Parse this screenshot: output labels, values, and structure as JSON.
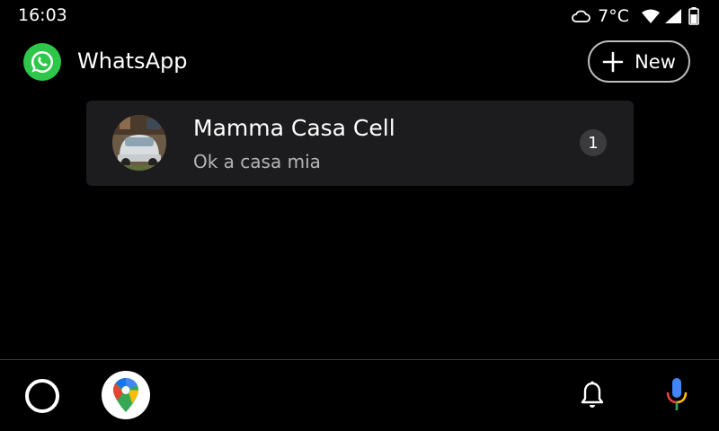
{
  "status_bar": {
    "time": "16:03",
    "temperature": "7°C",
    "weather_icon": "cloud-icon",
    "wifi_icon": "wifi-icon",
    "signal_icon": "cell-signal-icon",
    "battery_icon": "battery-icon"
  },
  "header": {
    "app_title": "WhatsApp",
    "app_icon": "whatsapp-icon",
    "new_button_label": "New"
  },
  "conversations": [
    {
      "name": "Mamma Casa Cell",
      "last_message": "Ok a casa mia",
      "unread_count": "1"
    }
  ],
  "bottom_bar": {
    "items": [
      "home-icon",
      "google-maps-icon",
      "bell-icon",
      "microphone-icon"
    ]
  },
  "colors": {
    "background": "#000000",
    "card": "#1c1c1e",
    "whatsapp_green": "#2ec74a",
    "badge": "#3b3b3d"
  }
}
